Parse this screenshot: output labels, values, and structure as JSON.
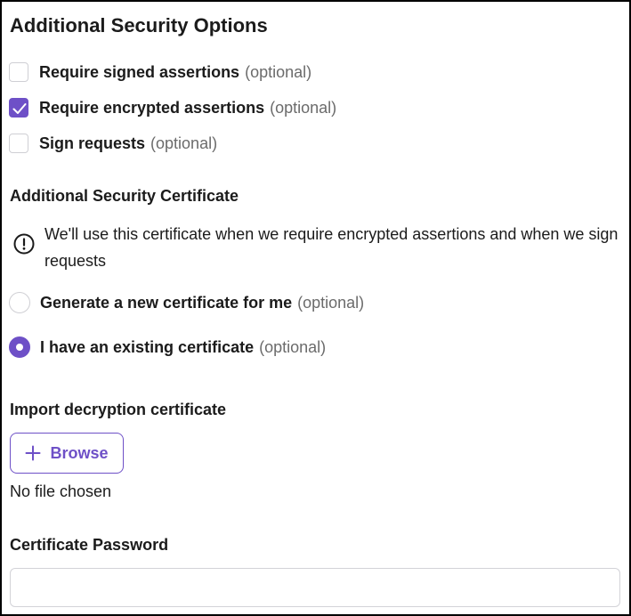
{
  "title": "Additional Security Options",
  "optional_text": "(optional)",
  "options": [
    {
      "label": "Require signed assertions",
      "checked": false
    },
    {
      "label": "Require encrypted assertions",
      "checked": true
    },
    {
      "label": "Sign requests",
      "checked": false
    }
  ],
  "certificate_section": {
    "heading": "Additional Security Certificate",
    "info_icon": "exclamation-circle-icon",
    "info_text": "We'll use this certificate when we require encrypted assertions and when we sign requests",
    "choices": [
      {
        "label": "Generate a new certificate for me",
        "selected": false
      },
      {
        "label": "I have an existing certificate",
        "selected": true
      }
    ]
  },
  "import_section": {
    "heading": "Import decryption certificate",
    "browse_label": "Browse",
    "browse_icon": "plus-icon",
    "file_status": "No file chosen"
  },
  "password_section": {
    "heading": "Certificate Password",
    "value": "",
    "placeholder": ""
  },
  "colors": {
    "accent": "#6e50c7",
    "text": "#1b1b1b",
    "muted": "#6b6b6b",
    "border": "#cfcfd4"
  }
}
